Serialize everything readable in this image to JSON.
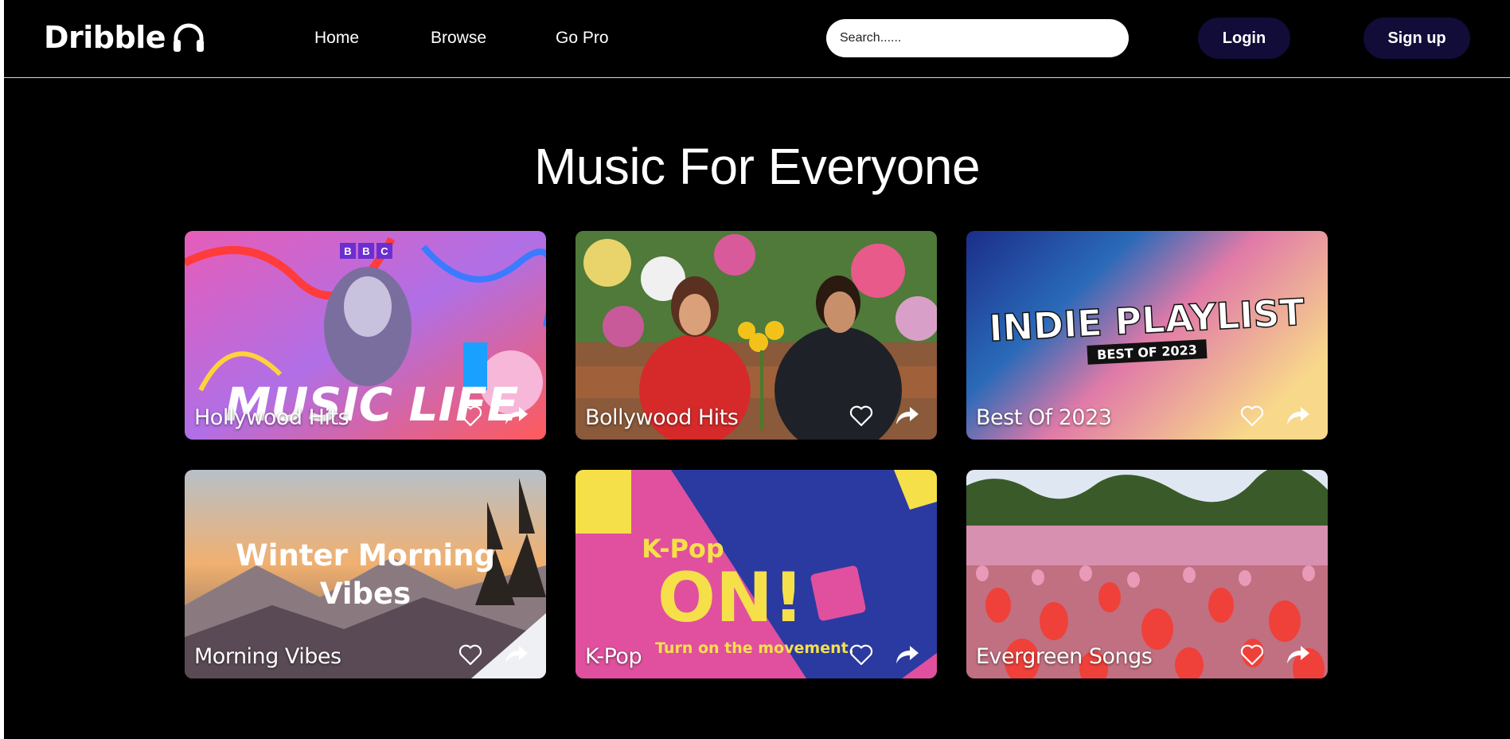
{
  "nav": {
    "logo_text": "Dribble",
    "links": [
      "Home",
      "Browse",
      "Go Pro"
    ],
    "search_placeholder": "Search......",
    "login_label": "Login",
    "signup_label": "Sign up"
  },
  "hero": {
    "title": "Music For Everyone"
  },
  "cards": [
    {
      "title": "Hollywood Hits",
      "art_text": [
        "BBC",
        "MUSIC LIFE"
      ]
    },
    {
      "title": "Bollywood Hits",
      "art_text": []
    },
    {
      "title": "Best Of 2023",
      "art_text": [
        "INDIE PLAYLIST",
        "BEST OF 2023"
      ]
    },
    {
      "title": "Morning Vibes",
      "art_text": [
        "Winter Morning",
        "Vibes"
      ]
    },
    {
      "title": "K-Pop",
      "art_text": [
        "K-Pop",
        "ON!",
        "Turn on the movement."
      ]
    },
    {
      "title": "Evergreen Songs",
      "art_text": []
    }
  ],
  "colors": {
    "background": "#000000",
    "button": "#120c38",
    "text": "#ffffff"
  },
  "icons": [
    "headphones-icon",
    "heart-icon",
    "share-arrow-icon"
  ]
}
